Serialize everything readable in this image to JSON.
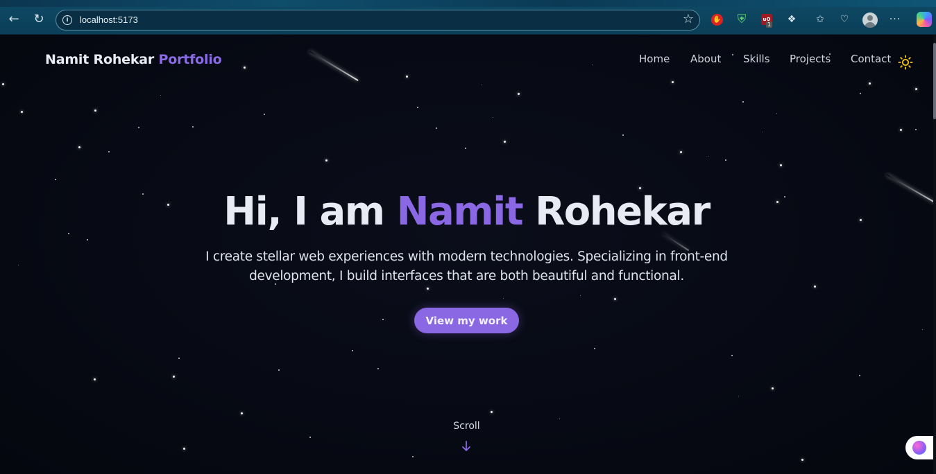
{
  "browser": {
    "url": "localhost:5173",
    "extensions": [
      "adblock-icon",
      "shield-icon",
      "ublock-icon",
      "puzzle-icon",
      "favorites-icon",
      "health-icon",
      "profile-avatar",
      "more-icon",
      "copilot-icon"
    ],
    "ublock_badge": "1"
  },
  "site": {
    "brand_name": "Namit Rohekar",
    "brand_accent": "Portfolio",
    "nav": {
      "home": "Home",
      "about": "About",
      "skills": "Skills",
      "projects": "Projects",
      "contact": "Contact"
    },
    "theme_icon": "sun-icon"
  },
  "hero": {
    "title_prefix": "Hi, I am",
    "title_accent": "Namit",
    "title_suffix": "Rohekar",
    "subtitle_line1": "I create stellar web experiences with modern technologies. Specializing in front-end",
    "subtitle_line2": "development, I build interfaces that are both beautiful and functional.",
    "cta_label": "View my work",
    "scroll_label": "Scroll"
  },
  "colors": {
    "accent": "#8a68e3",
    "background": "#05070f",
    "browser_bar": "#0f4a66"
  }
}
